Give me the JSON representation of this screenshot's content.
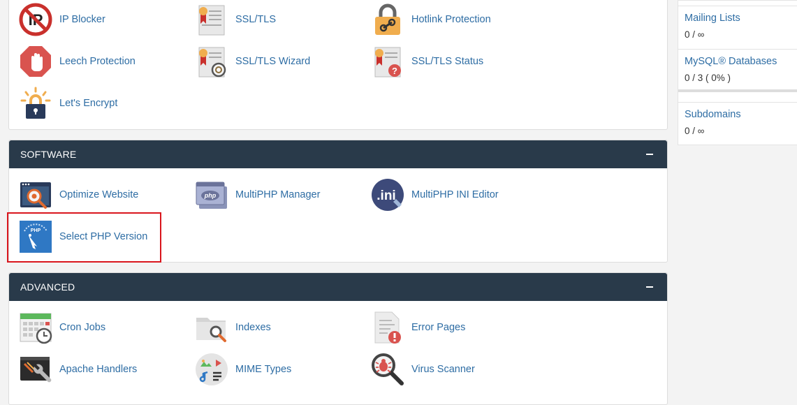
{
  "security": {
    "items": [
      {
        "label": "IP Blocker",
        "icon": "ip-blocker-icon"
      },
      {
        "label": "SSL/TLS",
        "icon": "certificate-icon"
      },
      {
        "label": "Hotlink Protection",
        "icon": "padlock-link-icon"
      },
      {
        "label": "Leech Protection",
        "icon": "stop-hand-icon"
      },
      {
        "label": "SSL/TLS Wizard",
        "icon": "certificate-wizard-icon"
      },
      {
        "label": "SSL/TLS Status",
        "icon": "certificate-question-icon"
      },
      {
        "label": "Let's Encrypt",
        "icon": "lock-bulb-icon"
      }
    ]
  },
  "software": {
    "title": "SOFTWARE",
    "items": [
      {
        "label": "Optimize Website",
        "icon": "optimize-website-icon"
      },
      {
        "label": "MultiPHP Manager",
        "icon": "php-window-icon"
      },
      {
        "label": "MultiPHP INI Editor",
        "icon": "ini-editor-icon"
      },
      {
        "label": "Select PHP Version",
        "icon": "php-gauge-icon"
      }
    ]
  },
  "advanced": {
    "title": "ADVANCED",
    "items": [
      {
        "label": "Cron Jobs",
        "icon": "calendar-clock-icon"
      },
      {
        "label": "Indexes",
        "icon": "folder-search-icon"
      },
      {
        "label": "Error Pages",
        "icon": "document-error-icon"
      },
      {
        "label": "Apache Handlers",
        "icon": "terminal-wrench-icon"
      },
      {
        "label": "MIME Types",
        "icon": "media-types-icon"
      },
      {
        "label": "Virus Scanner",
        "icon": "bug-magnifier-icon"
      }
    ]
  },
  "stats": {
    "mailing_lists": {
      "label": "Mailing Lists",
      "value": "0 / ∞"
    },
    "mysql_databases": {
      "label": "MySQL® Databases",
      "value": "0 / 3 ( 0% )",
      "usage_fraction": 0
    },
    "subdomains": {
      "label": "Subdomains",
      "value": "0 / ∞"
    }
  },
  "colors": {
    "panel_header": "#293a4a",
    "link": "#2e6da4",
    "highlight": "#d9161d"
  }
}
